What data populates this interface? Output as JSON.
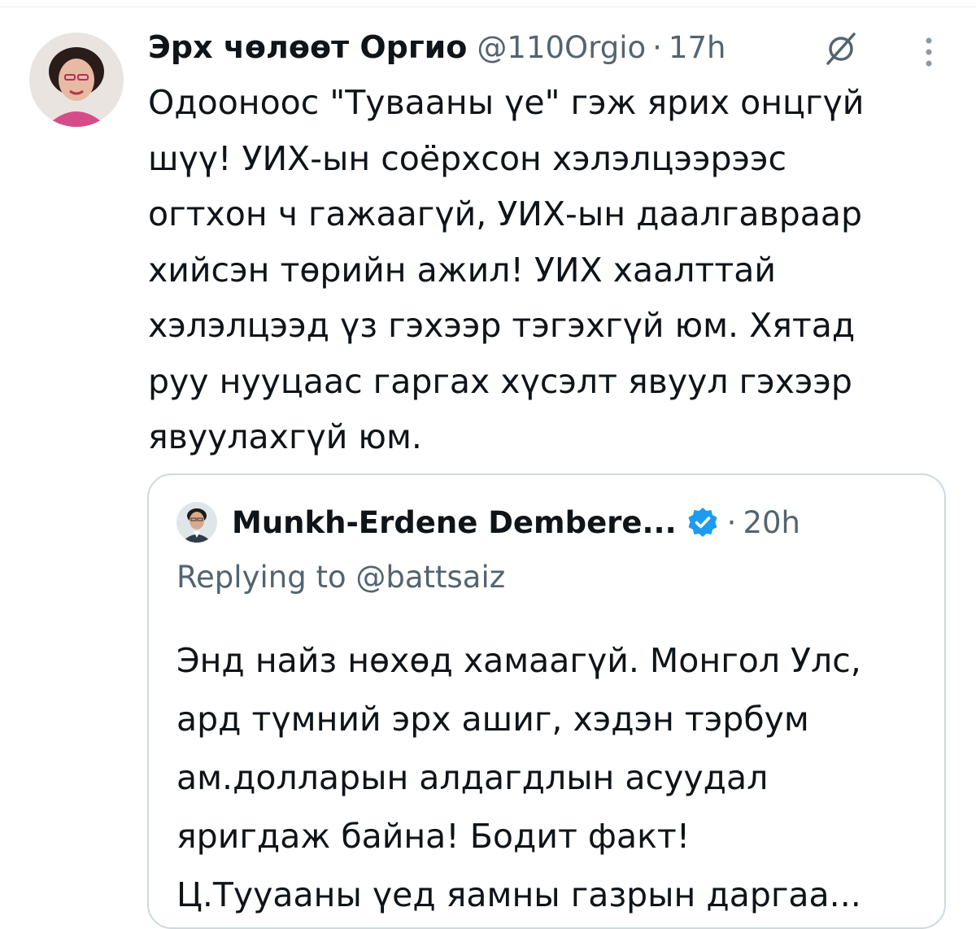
{
  "tweet": {
    "author": {
      "display_name": "Эрх чөлөөт Оргио",
      "handle": "@110Orgio",
      "avatar_icon": "profile-photo-woman"
    },
    "separator": "·",
    "time": "17h",
    "icons": [
      "grok-icon",
      "more-icon"
    ],
    "text_lines": [
      "Одооноос \"Тувааны үе\" гэж ярих онцгүй",
      "шүү! УИХ-ын соёрхсон хэлэлцээрээс",
      "огтхон ч гажаагүй, УИХ-ын даалгавраар",
      "хийсэн төрийн ажил! УИХ хаалттай",
      "хэлэлцээд үз гэхээр тэгэхгүй юм. Хятад",
      "руу нууцаас гаргах хүсэлт явуул гэхээр",
      "явуулахгүй юм."
    ]
  },
  "quoted_tweet": {
    "author": {
      "display_name": "Munkh-Erdene Dembere...",
      "verified": true,
      "avatar_icon": "profile-photo-man"
    },
    "separator": "·",
    "time": "20h",
    "replying_to": "Replying to @battsaiz",
    "text_lines": [
      "Энд найз нөхөд хамаагүй. Монгол Улс,",
      "ард түмний эрх ашиг, хэдэн тэрбум",
      "ам.долларын алдагдлын асуудал",
      "яригдаж байна! Бодит факт!",
      "Ц.Тууааны үед яамны газрын даргаа..."
    ]
  },
  "colors": {
    "text_primary": "#0f1419",
    "text_secondary": "#536471",
    "border": "#cfd9de",
    "verified_blue": "#1d9bf0"
  }
}
